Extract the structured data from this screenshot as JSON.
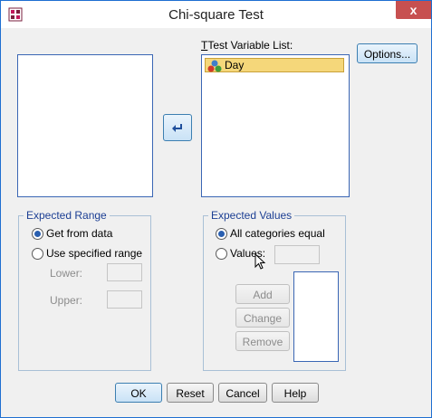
{
  "window": {
    "title": "Chi-square Test",
    "close_glyph": "x"
  },
  "source_list": {
    "items": []
  },
  "move_button": {
    "icon": "arrow-left-icon"
  },
  "test_variable_list": {
    "label": "Test Variable List:",
    "items": [
      {
        "name": "Day",
        "icon": "nominal-variable-icon"
      }
    ]
  },
  "options_button": {
    "label": "Options..."
  },
  "expected_range": {
    "legend": "Expected Range",
    "options": [
      {
        "label": "Get from data",
        "selected": true
      },
      {
        "label": "Use specified range",
        "selected": false
      }
    ],
    "lower_label": "Lower:",
    "lower_value": "",
    "upper_label": "Upper:",
    "upper_value": ""
  },
  "expected_values": {
    "legend": "Expected Values",
    "options": [
      {
        "label": "All categories equal",
        "selected": true
      },
      {
        "label": "Values:",
        "selected": false
      }
    ],
    "values_input": "",
    "add_label": "Add",
    "change_label": "Change",
    "remove_label": "Remove",
    "values_list": []
  },
  "footer": {
    "ok": "OK",
    "reset": "Reset",
    "cancel": "Cancel",
    "help": "Help"
  },
  "colors": {
    "accent": "#1e6fd1",
    "close": "#c75050",
    "selection": "#f5d77a",
    "group_border": "#a9c0d6",
    "legend_text": "#1c3f94"
  }
}
